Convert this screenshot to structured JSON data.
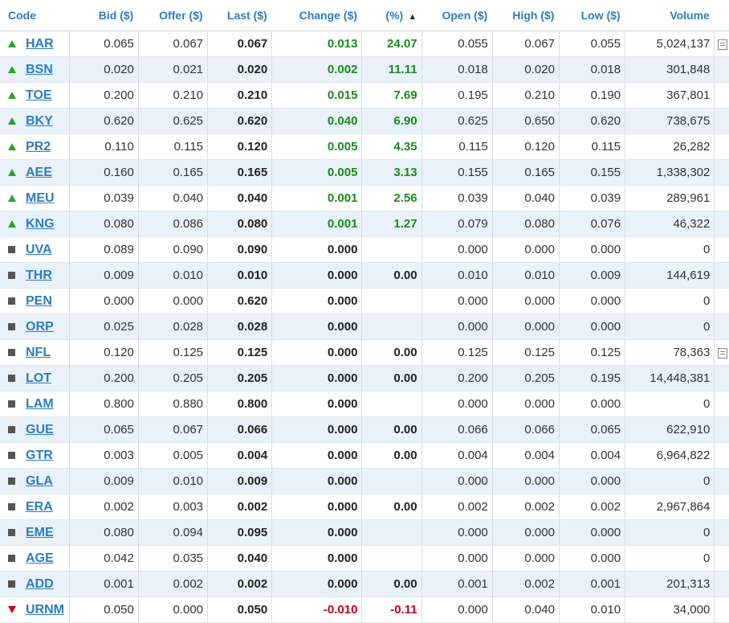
{
  "headers": {
    "code": "Code",
    "bid": "Bid ($)",
    "offer": "Offer ($)",
    "last": "Last ($)",
    "change": "Change ($)",
    "pct": "(%)",
    "open": "Open ($)",
    "high": "High ($)",
    "low": "Low ($)",
    "volume": "Volume"
  },
  "sort": {
    "column": "pct",
    "icon": "chevron-up-icon"
  },
  "colors": {
    "link": "#2d7dbf",
    "up": "#1a8a1a",
    "down": "#c0001a",
    "alt_row": "#e9f2f9"
  },
  "rows": [
    {
      "dir": "up",
      "code": "HAR",
      "bid": "0.065",
      "offer": "0.067",
      "last": "0.067",
      "change": "0.013",
      "pct": "24.07",
      "open": "0.055",
      "high": "0.067",
      "low": "0.055",
      "volume": "5,024,137",
      "ann": true
    },
    {
      "dir": "up",
      "code": "BSN",
      "bid": "0.020",
      "offer": "0.021",
      "last": "0.020",
      "change": "0.002",
      "pct": "11.11",
      "open": "0.018",
      "high": "0.020",
      "low": "0.018",
      "volume": "301,848",
      "ann": false
    },
    {
      "dir": "up",
      "code": "TOE",
      "bid": "0.200",
      "offer": "0.210",
      "last": "0.210",
      "change": "0.015",
      "pct": "7.69",
      "open": "0.195",
      "high": "0.210",
      "low": "0.190",
      "volume": "367,801",
      "ann": false
    },
    {
      "dir": "up",
      "code": "BKY",
      "bid": "0.620",
      "offer": "0.625",
      "last": "0.620",
      "change": "0.040",
      "pct": "6.90",
      "open": "0.625",
      "high": "0.650",
      "low": "0.620",
      "volume": "738,675",
      "ann": false
    },
    {
      "dir": "up",
      "code": "PR2",
      "bid": "0.110",
      "offer": "0.115",
      "last": "0.120",
      "change": "0.005",
      "pct": "4.35",
      "open": "0.115",
      "high": "0.120",
      "low": "0.115",
      "volume": "26,282",
      "ann": false
    },
    {
      "dir": "up",
      "code": "AEE",
      "bid": "0.160",
      "offer": "0.165",
      "last": "0.165",
      "change": "0.005",
      "pct": "3.13",
      "open": "0.155",
      "high": "0.165",
      "low": "0.155",
      "volume": "1,338,302",
      "ann": false
    },
    {
      "dir": "up",
      "code": "MEU",
      "bid": "0.039",
      "offer": "0.040",
      "last": "0.040",
      "change": "0.001",
      "pct": "2.56",
      "open": "0.039",
      "high": "0.040",
      "low": "0.039",
      "volume": "289,961",
      "ann": false
    },
    {
      "dir": "up",
      "code": "KNG",
      "bid": "0.080",
      "offer": "0.086",
      "last": "0.080",
      "change": "0.001",
      "pct": "1.27",
      "open": "0.079",
      "high": "0.080",
      "low": "0.076",
      "volume": "46,322",
      "ann": false
    },
    {
      "dir": "flat",
      "code": "UVA",
      "bid": "0.089",
      "offer": "0.090",
      "last": "0.090",
      "change": "0.000",
      "pct": "",
      "open": "0.000",
      "high": "0.000",
      "low": "0.000",
      "volume": "0",
      "ann": false
    },
    {
      "dir": "flat",
      "code": "THR",
      "bid": "0.009",
      "offer": "0.010",
      "last": "0.010",
      "change": "0.000",
      "pct": "0.00",
      "open": "0.010",
      "high": "0.010",
      "low": "0.009",
      "volume": "144,619",
      "ann": false
    },
    {
      "dir": "flat",
      "code": "PEN",
      "bid": "0.000",
      "offer": "0.000",
      "last": "0.620",
      "change": "0.000",
      "pct": "",
      "open": "0.000",
      "high": "0.000",
      "low": "0.000",
      "volume": "0",
      "ann": false
    },
    {
      "dir": "flat",
      "code": "ORP",
      "bid": "0.025",
      "offer": "0.028",
      "last": "0.028",
      "change": "0.000",
      "pct": "",
      "open": "0.000",
      "high": "0.000",
      "low": "0.000",
      "volume": "0",
      "ann": false
    },
    {
      "dir": "flat",
      "code": "NFL",
      "bid": "0.120",
      "offer": "0.125",
      "last": "0.125",
      "change": "0.000",
      "pct": "0.00",
      "open": "0.125",
      "high": "0.125",
      "low": "0.125",
      "volume": "78,363",
      "ann": true
    },
    {
      "dir": "flat",
      "code": "LOT",
      "bid": "0.200",
      "offer": "0.205",
      "last": "0.205",
      "change": "0.000",
      "pct": "0.00",
      "open": "0.200",
      "high": "0.205",
      "low": "0.195",
      "volume": "14,448,381",
      "ann": false
    },
    {
      "dir": "flat",
      "code": "LAM",
      "bid": "0.800",
      "offer": "0.880",
      "last": "0.800",
      "change": "0.000",
      "pct": "",
      "open": "0.000",
      "high": "0.000",
      "low": "0.000",
      "volume": "0",
      "ann": false
    },
    {
      "dir": "flat",
      "code": "GUE",
      "bid": "0.065",
      "offer": "0.067",
      "last": "0.066",
      "change": "0.000",
      "pct": "0.00",
      "open": "0.066",
      "high": "0.066",
      "low": "0.065",
      "volume": "622,910",
      "ann": false
    },
    {
      "dir": "flat",
      "code": "GTR",
      "bid": "0.003",
      "offer": "0.005",
      "last": "0.004",
      "change": "0.000",
      "pct": "0.00",
      "open": "0.004",
      "high": "0.004",
      "low": "0.004",
      "volume": "6,964,822",
      "ann": false
    },
    {
      "dir": "flat",
      "code": "GLA",
      "bid": "0.009",
      "offer": "0.010",
      "last": "0.009",
      "change": "0.000",
      "pct": "",
      "open": "0.000",
      "high": "0.000",
      "low": "0.000",
      "volume": "0",
      "ann": false
    },
    {
      "dir": "flat",
      "code": "ERA",
      "bid": "0.002",
      "offer": "0.003",
      "last": "0.002",
      "change": "0.000",
      "pct": "0.00",
      "open": "0.002",
      "high": "0.002",
      "low": "0.002",
      "volume": "2,967,864",
      "ann": false
    },
    {
      "dir": "flat",
      "code": "EME",
      "bid": "0.080",
      "offer": "0.094",
      "last": "0.095",
      "change": "0.000",
      "pct": "",
      "open": "0.000",
      "high": "0.000",
      "low": "0.000",
      "volume": "0",
      "ann": false
    },
    {
      "dir": "flat",
      "code": "AGE",
      "bid": "0.042",
      "offer": "0.035",
      "last": "0.040",
      "change": "0.000",
      "pct": "",
      "open": "0.000",
      "high": "0.000",
      "low": "0.000",
      "volume": "0",
      "ann": false
    },
    {
      "dir": "flat",
      "code": "ADD",
      "bid": "0.001",
      "offer": "0.002",
      "last": "0.002",
      "change": "0.000",
      "pct": "0.00",
      "open": "0.001",
      "high": "0.002",
      "low": "0.001",
      "volume": "201,313",
      "ann": false
    },
    {
      "dir": "down",
      "code": "URNM",
      "bid": "0.050",
      "offer": "0.000",
      "last": "0.050",
      "change": "-0.010",
      "pct": "-0.11",
      "open": "0.000",
      "high": "0.040",
      "low": "0.010",
      "volume": "34,000",
      "ann": false
    }
  ]
}
